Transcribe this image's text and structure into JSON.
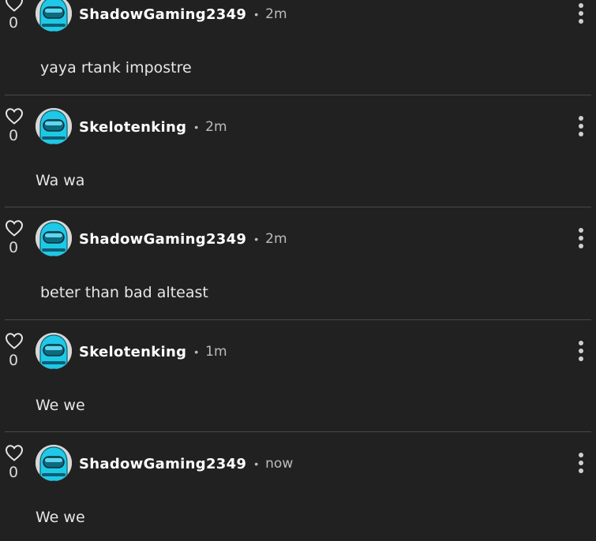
{
  "comments": [
    {
      "username": "ShadowGaming2349",
      "separator": "•",
      "time": "2m",
      "likes": "0",
      "text": "yaya rtank impostre"
    },
    {
      "username": "Skelotenking",
      "separator": "•",
      "time": "2m",
      "likes": "0",
      "text": "Wa wa"
    },
    {
      "username": "ShadowGaming2349",
      "separator": "•",
      "time": "2m",
      "likes": "0",
      "text": "beter than bad alteast"
    },
    {
      "username": "Skelotenking",
      "separator": "•",
      "time": "1m",
      "likes": "0",
      "text": "We we"
    },
    {
      "username": "ShadowGaming2349",
      "separator": "•",
      "time": "now",
      "likes": "0",
      "text": "We we"
    }
  ],
  "colors": {
    "background": "#212121",
    "divider": "#4a4a4a",
    "avatar_body": "#1fc8e6",
    "avatar_bg": "#d7d7d7",
    "text": "#ffffff",
    "muted": "#bdbdbd"
  },
  "icons": {
    "like": "heart-outline-icon",
    "menu": "vertical-ellipsis-icon",
    "avatar": "crewmate-avatar"
  }
}
